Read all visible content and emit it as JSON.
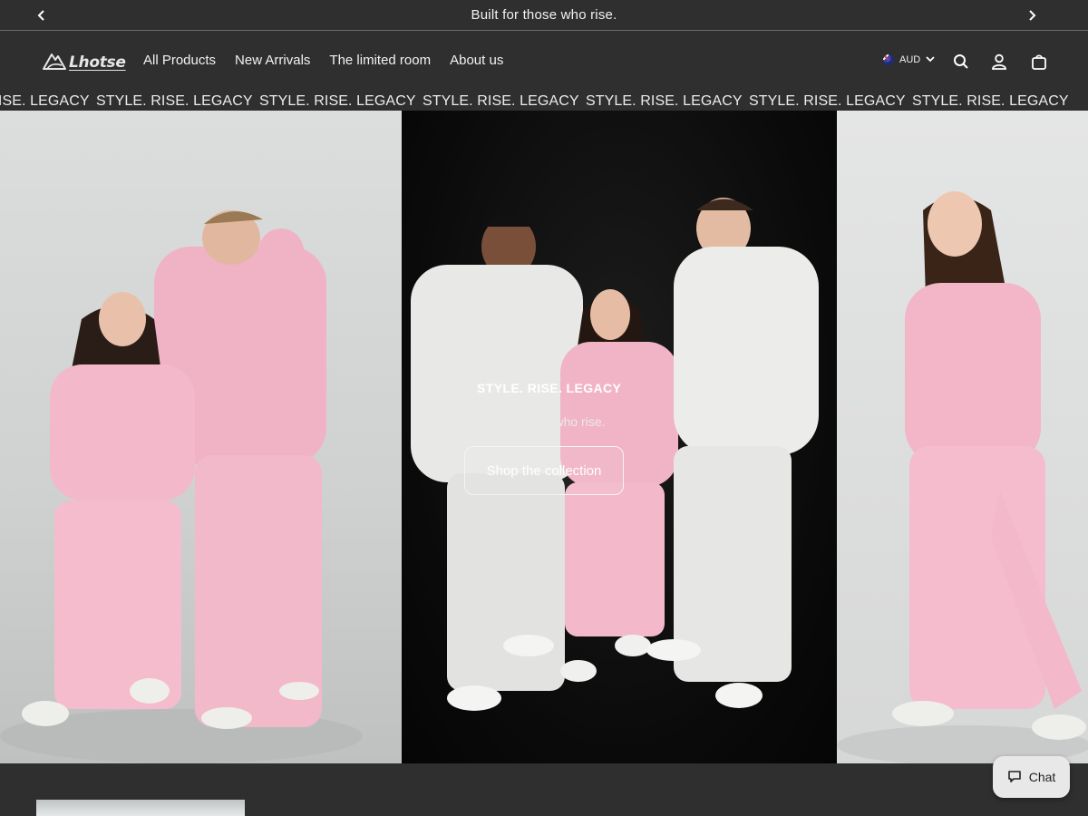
{
  "announcement": {
    "text": "Built for those who rise."
  },
  "brand": {
    "name": "Lhotse"
  },
  "nav": {
    "items": [
      "All Products",
      "New Arrivals",
      "The limited room",
      "About us"
    ]
  },
  "currency": {
    "code": "AUD"
  },
  "marquee": {
    "items": [
      "STYLE. RISE. LEGACY",
      "STYLE. RISE. LEGACY",
      "STYLE. RISE. LEGACY",
      "STYLE. RISE. LEGACY",
      "STYLE. RISE. LEGACY",
      "STYLE. RISE. LEGACY",
      "STYLE. RISE. LEGACY"
    ]
  },
  "hero": {
    "title": "STYLE. RISE. LEGACY",
    "subtitle": "Built for those who rise.",
    "cta": "Shop the collection"
  },
  "chat": {
    "label": "Chat"
  },
  "icons": {
    "prev": "chevron-left-icon",
    "next": "chevron-right-icon",
    "currency_toggle": "chevron-down-icon",
    "search": "search-icon",
    "account": "user-icon",
    "cart": "bag-icon",
    "chat": "chat-bubble-icon",
    "logo": "mountain-icon"
  },
  "colors": {
    "background": "#2f2f2f",
    "pink_apparel": "#f1b6c8",
    "grey_apparel": "#e7e7e5"
  }
}
